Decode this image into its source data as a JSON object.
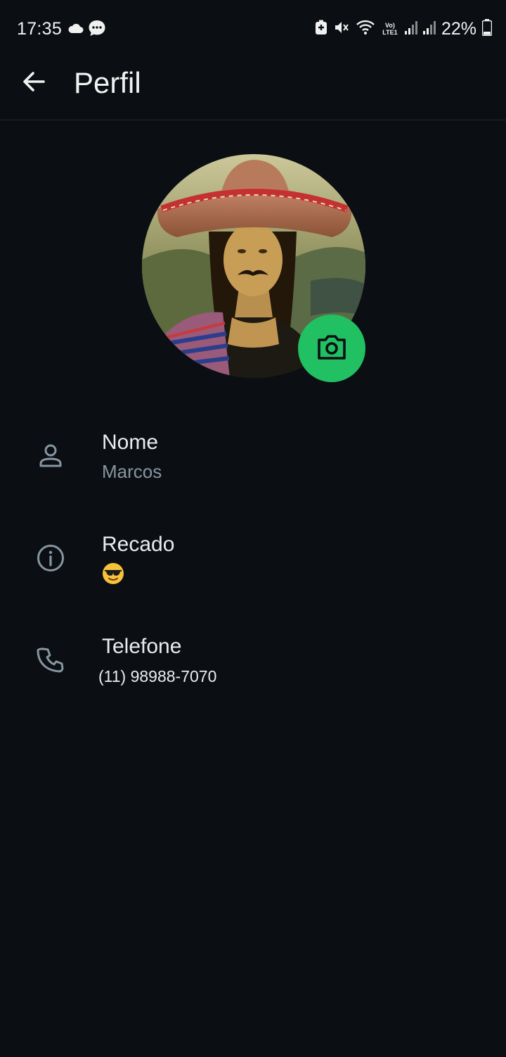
{
  "status_bar": {
    "time": "17:35",
    "battery": "22%",
    "network_label": "Vo) LTE1",
    "icons": [
      "cloud-icon",
      "chat-bubble-icon",
      "battery-saver-icon",
      "mute-icon",
      "wifi-icon",
      "signal-icon",
      "signal-icon",
      "battery-icon"
    ]
  },
  "app_bar": {
    "title": "Perfil",
    "back_icon": "arrow-left-icon"
  },
  "profile": {
    "edit_photo_icon": "camera-icon",
    "accent_color": "#21c063"
  },
  "fields": [
    {
      "icon": "person-icon",
      "label": "Nome",
      "value": "Marcos"
    },
    {
      "icon": "info-icon",
      "label": "Recado",
      "value": "😎"
    },
    {
      "icon": "phone-icon",
      "label": "Telefone",
      "value": "(11) 98988-7070"
    }
  ]
}
